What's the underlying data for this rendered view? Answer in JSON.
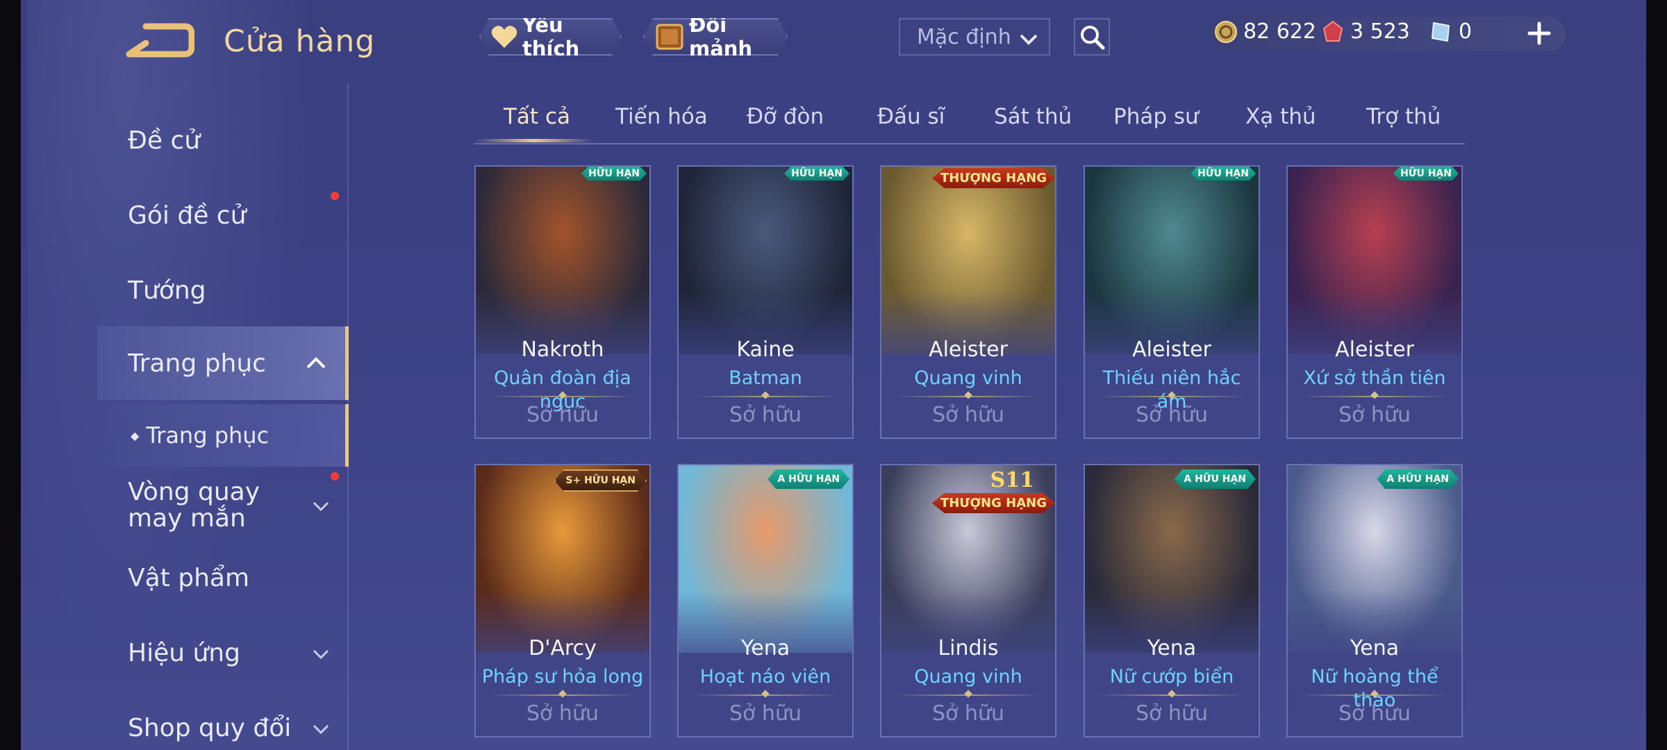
{
  "header": {
    "title": "Cửa hàng",
    "favorites_label": "Yêu thích",
    "shard_exchange_label": "Đổi mảnh",
    "sort": {
      "selected": "Mặc định"
    }
  },
  "currencies": {
    "gold": "82 622",
    "ruby": "3 523",
    "voucher": "0"
  },
  "sidebar": {
    "items": [
      {
        "label": "Đề cử"
      },
      {
        "label": "Gói đề cử"
      },
      {
        "label": "Tướng"
      },
      {
        "label": "Trang phục"
      },
      {
        "label": "Trang phục"
      },
      {
        "label": "Vòng quay may mắn"
      },
      {
        "label": "Vật phẩm"
      },
      {
        "label": "Hiệu ứng"
      },
      {
        "label": "Shop quy đổi"
      }
    ]
  },
  "tabs": [
    "Tất cả",
    "Tiến hóa",
    "Đỡ đòn",
    "Đấu sĩ",
    "Sát thủ",
    "Pháp sư",
    "Xạ thủ",
    "Trợ thủ"
  ],
  "cards": [
    {
      "hero": "Nakroth",
      "skin": "Quân đoàn địa ngục",
      "badge": "HỮU HẠN",
      "status": "Sở hữu",
      "color1": "#2c2a3a",
      "color2": "#a3542a"
    },
    {
      "hero": "Kaine",
      "skin": "Batman",
      "badge": "HỮU HẠN",
      "status": "Sở hữu",
      "color1": "#1f2538",
      "color2": "#4a5a7c"
    },
    {
      "hero": "Aleister",
      "skin": "Quang vinh",
      "badge": "THƯỢNG HẠNG",
      "status": "Sở hữu",
      "color1": "#6b5a30",
      "color2": "#d7b766"
    },
    {
      "hero": "Aleister",
      "skin": "Thiếu niên hắc ám",
      "badge": "HỮU HẠN",
      "status": "Sở hữu",
      "color1": "#1c3640",
      "color2": "#4f8a90"
    },
    {
      "hero": "Aleister",
      "skin": "Xứ sở thần tiên",
      "badge": "HỮU HẠN",
      "status": "Sở hữu",
      "color1": "#3a2350",
      "color2": "#b84050"
    },
    {
      "hero": "D'Arcy",
      "skin": "Pháp sư hỏa long",
      "badge": "S+ HỮU HẠN",
      "status": "Sở hữu",
      "color1": "#5a2a1a",
      "color2": "#e89a3a"
    },
    {
      "hero": "Yena",
      "skin": "Hoạt náo viên",
      "badge": "A HỮU HẠN",
      "status": "Sở hữu",
      "color1": "#6fb8d8",
      "color2": "#e89a6a"
    },
    {
      "hero": "Lindis",
      "skin": "Quang vinh",
      "badge": "THƯỢNG HẠNG",
      "badge_top": "S11",
      "status": "Sở hữu",
      "color1": "#3a3e5a",
      "color2": "#c8c8d8"
    },
    {
      "hero": "Yena",
      "skin": "Nữ cướp biển",
      "badge": "A HỮU HẠN",
      "status": "Sở hữu",
      "color1": "#2a2a3a",
      "color2": "#8a6a4a"
    },
    {
      "hero": "Yena",
      "skin": "Nữ hoàng thể thao",
      "badge": "A HỮU HẠN",
      "status": "Sở hữu",
      "color1": "#4a5a8a",
      "color2": "#d8d8e8"
    }
  ]
}
